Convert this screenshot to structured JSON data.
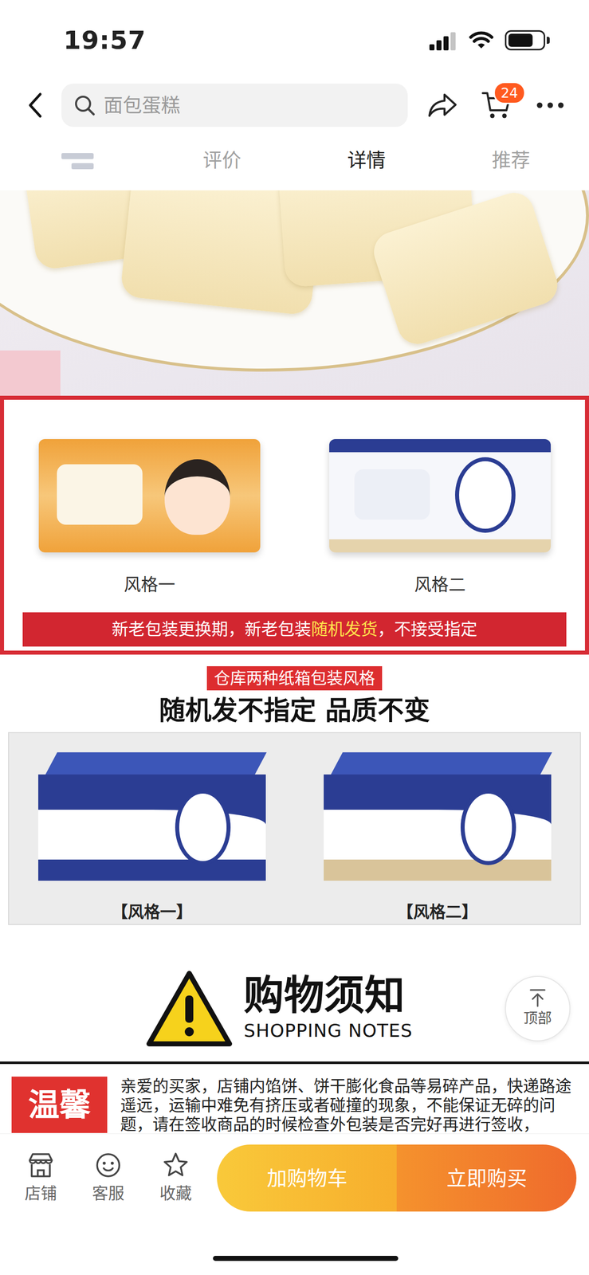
{
  "status_bar": {
    "time": "19:57",
    "signal": {
      "level": 0.75
    },
    "battery": {
      "level": 0.72
    }
  },
  "search": {
    "placeholder": "面包蛋糕"
  },
  "cart": {
    "badge": "24"
  },
  "tabs": [
    {
      "kind": "redacted",
      "selected": false
    },
    {
      "kind": "text",
      "label": "评价",
      "selected": false
    },
    {
      "kind": "text",
      "label": "详情",
      "selected": true
    },
    {
      "kind": "text",
      "label": "推荐",
      "selected": false
    }
  ],
  "packaging": {
    "styles": [
      {
        "label": "风格一",
        "color": "#f0a23a"
      },
      {
        "label": "风格二",
        "color": "#2b3d93"
      }
    ],
    "notice": [
      "新老包装更换期，新老包装",
      "随机发货",
      "，不接受指定"
    ]
  },
  "cartons": {
    "tag": "仓库两种纸箱包装风格",
    "headline": "随机发不指定 品质不变",
    "styles": [
      {
        "label": "【风格一】",
        "color": "#2b3d93"
      },
      {
        "label": "【风格二】",
        "color": "#d9c49a"
      }
    ]
  },
  "shopping_notes": {
    "title": "购物须知",
    "subtitle": "SHOPPING NOTES",
    "tag": "温馨",
    "text": "亲爱的买家，店铺内馅饼、饼干膨化食品等易碎产品，快递路途遥远，运输中难免有挤压或者碰撞的现象，不能保证无碎的问题，请在签收商品的时候检查外包装是否完好再进行签收，"
  },
  "back_to_top": {
    "label": "顶部"
  },
  "bottom_bar": {
    "icons": [
      {
        "label": "店铺"
      },
      {
        "label": "客服"
      },
      {
        "label": "收藏"
      }
    ],
    "buttons": [
      {
        "label": "加购物车"
      },
      {
        "label": "立即购买"
      }
    ]
  }
}
